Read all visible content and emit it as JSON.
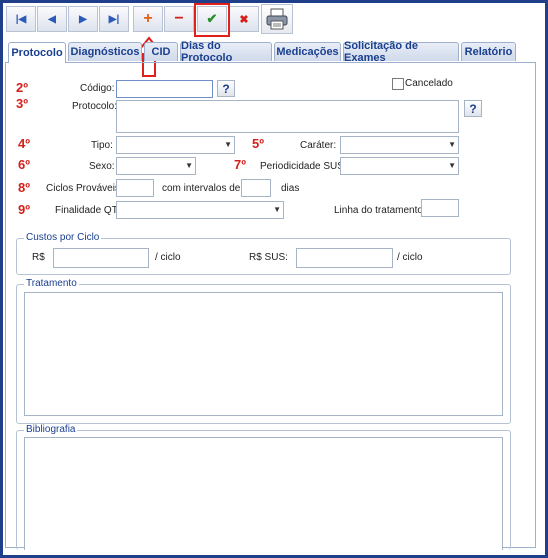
{
  "toolbar": {
    "first": "|◀",
    "prev": "◀",
    "next": "▶",
    "last": "▶|",
    "add": "+",
    "remove": "−",
    "confirm": "✔",
    "cancel": "✖"
  },
  "tabs": [
    "Protocolo",
    "Diagnósticos",
    "CID",
    "Dias do Protocolo",
    "Medicações",
    "Solicitação de Exames",
    "Relatório"
  ],
  "markers": [
    "2º",
    "3º",
    "4º",
    "5º",
    "6º",
    "7º",
    "8º",
    "9º"
  ],
  "form": {
    "codigo_label": "Código:",
    "codigo_value": "",
    "help": "?",
    "cancelado_label": "Cancelado",
    "protocolo_label": "Protocolo:",
    "tipo_label": "Tipo:",
    "carater_label": "Caráter:",
    "sexo_label": "Sexo:",
    "periodicidade_label": "Periodicidade SUS:",
    "ciclos_label": "Ciclos Prováveis:",
    "intervalos_label": "com intervalos de",
    "dias_label": "dias",
    "finalidade_label": "Finalidade QT:",
    "linha_label": "Linha do tratamento:"
  },
  "custos": {
    "legend": "Custos por Ciclo",
    "rs_label": "R$",
    "ciclo1": "/ ciclo",
    "rs_sus_label": "R$ SUS:",
    "ciclo2": "/ ciclo"
  },
  "tratamento": {
    "legend": "Tratamento"
  },
  "bibliografia": {
    "legend": "Bibliografia"
  },
  "colors": {
    "accent": "#1a3f8f",
    "annotation_red": "#e0211b"
  }
}
